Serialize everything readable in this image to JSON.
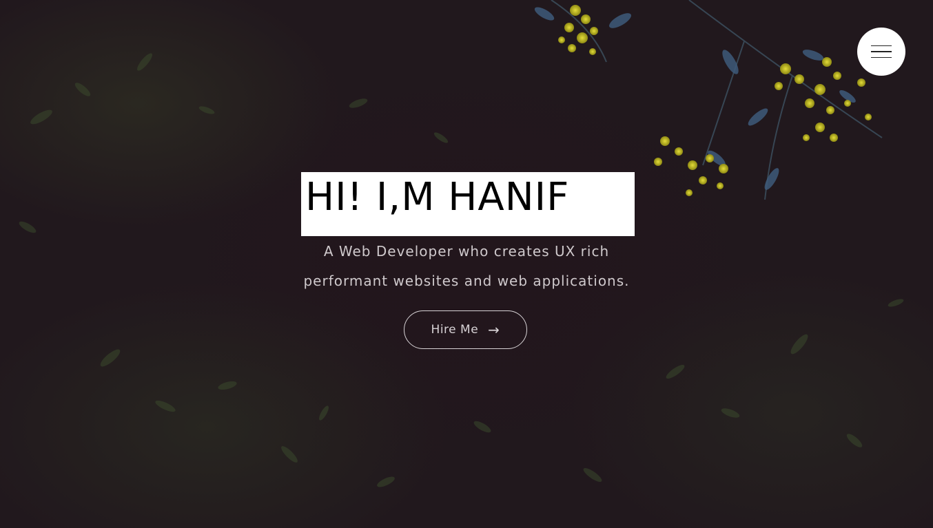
{
  "nav": {
    "menu_icon": "hamburger-menu-icon"
  },
  "hero": {
    "headline": "HI! I,M HANIF",
    "subtitle_line1": "A Web Developer who creates UX rich",
    "subtitle_line2": "performant websites and web applications.",
    "cta_label": "Hire Me",
    "cta_icon": "arrow-right-icon",
    "cta_icon_glyph": "→"
  },
  "colors": {
    "background": "#21181d",
    "headline_box": "#ffffff",
    "text_light": "#cfc9cc",
    "flower_yellow": "#c9c21f",
    "leaf_blue": "#3e5a7a"
  }
}
